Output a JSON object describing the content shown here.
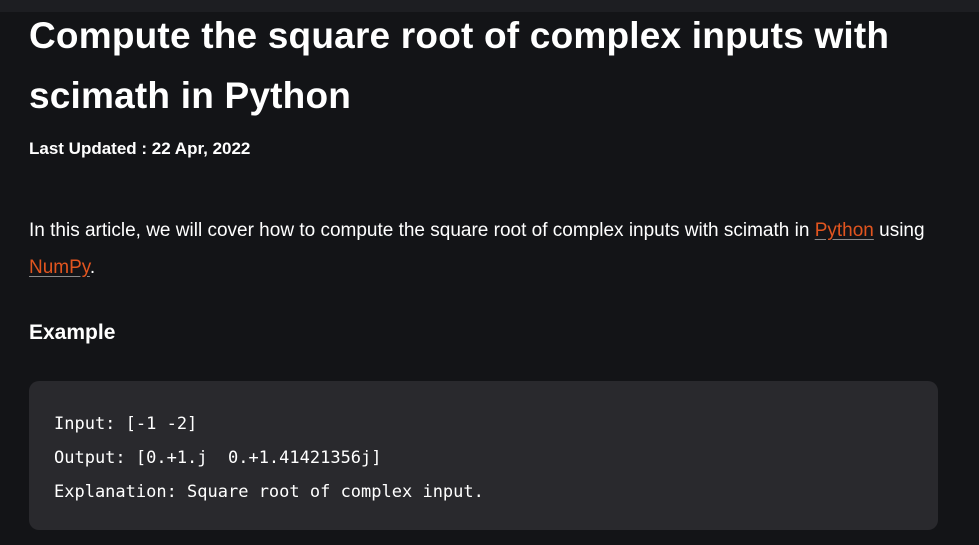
{
  "article": {
    "title": "Compute the square root of complex inputs with scimath in Python",
    "last_updated": "Last Updated : 22 Apr, 2022",
    "intro": {
      "text_before": "In this article, we will cover how to compute the square root of complex inputs with scimath in ",
      "link_python": "Python",
      "text_middle": " using ",
      "link_numpy": "NumPy",
      "text_after": "."
    },
    "example_heading": "Example",
    "code_lines": [
      "Input: [-1 -2]",
      "Output: [0.+1.j  0.+1.41421356j]",
      "Explanation: Square root of complex input."
    ]
  },
  "colors": {
    "background": "#131417",
    "code_background": "#29292d",
    "link": "#e2551f",
    "text": "#ffffff"
  }
}
